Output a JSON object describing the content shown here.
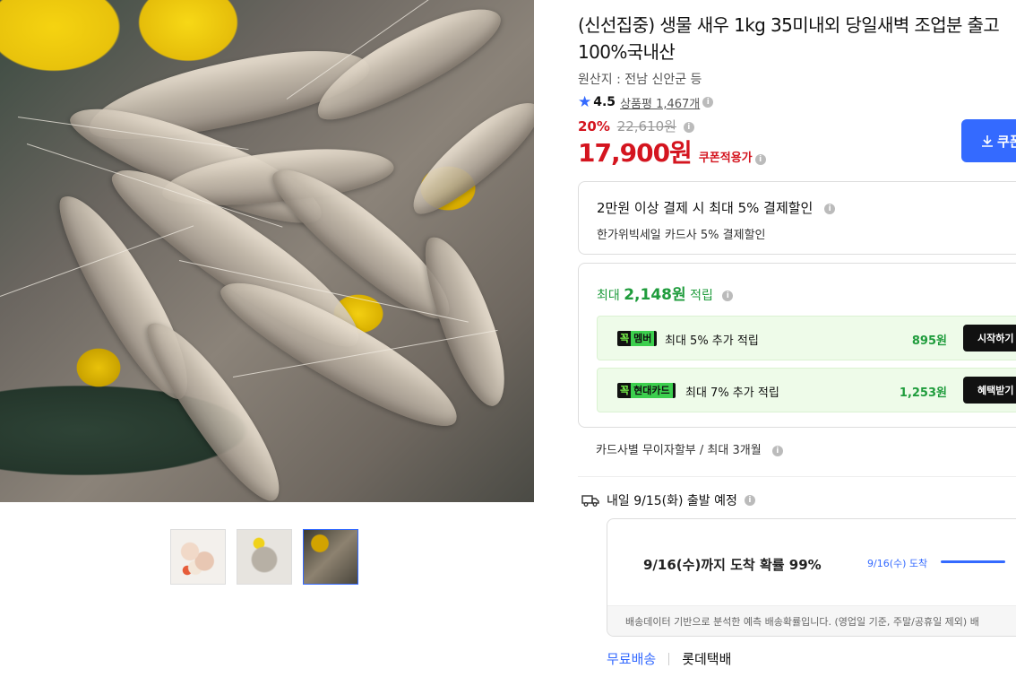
{
  "product": {
    "title": "(신선집중) 생물 새우 1kg 35미내외 당일새벽 조업분 출고 100%국내산",
    "origin": "원산지 : 전남 신안군 등",
    "rating": "4.5",
    "review_link": "상품평 1,467개",
    "discount_rate": "20%",
    "original_price": "22,610원",
    "price": "17,900원",
    "price_label": "쿠폰적용가",
    "coupon_button": "쿠폰"
  },
  "card_discount": {
    "line1": "2만원 이상 결제 시 최대 5% 결제할인",
    "line2": "한가위빅세일 카드사 5% 결제할인"
  },
  "rewards": {
    "title_prefix": "최대 ",
    "title_amount": "2,148원",
    "title_suffix": " 적립",
    "rows": [
      {
        "tag_main": "꼭",
        "tag_sub": "멤버",
        "text": "최대 5% 추가 적립",
        "amount": "895원",
        "button": "시작하기"
      },
      {
        "tag_main": "꼭",
        "tag_sub": "현대카드",
        "text": "최대 7% 추가 적립",
        "amount": "1,253원",
        "button": "혜택받기"
      }
    ]
  },
  "installment": "카드사별 무이자할부 / 최대 3개월",
  "shipping": {
    "departure": "내일 9/15(화) 출발 예정",
    "arrival": "9/16(수)까지 도착 확률 99%",
    "mini_label": "9/16(수) 도착",
    "arrival_probability": 0.99,
    "footer": "배송데이터 기반으로 분석한 예측 배송확률입니다. (영업일 기준, 주말/공휴일 제외) 배",
    "fee": "무료배송",
    "carrier": "롯데택배"
  },
  "icons": {
    "star": "star-icon",
    "info": "info-icon",
    "truck": "truck-icon",
    "download": "download-icon"
  },
  "colors": {
    "accent": "#346aff",
    "price": "#d4151f",
    "reward": "#1f9c3c"
  }
}
